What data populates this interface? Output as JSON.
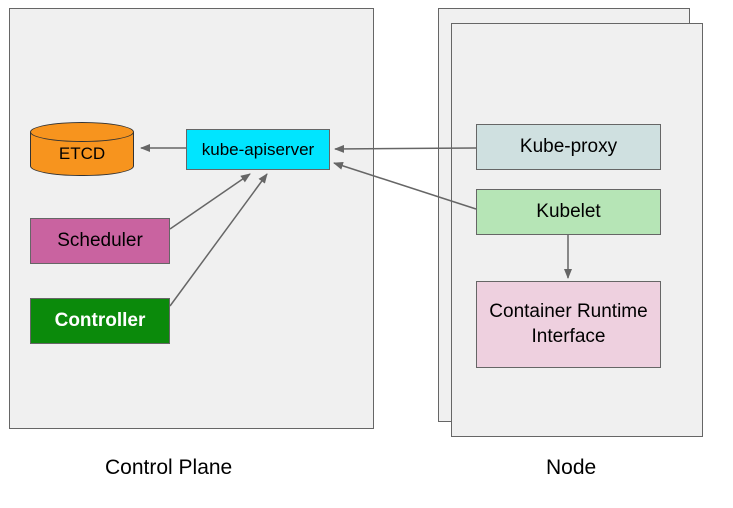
{
  "diagram": {
    "control_plane": {
      "label": "Control Plane",
      "etcd": "ETCD",
      "apiserver": "kube-apiserver",
      "scheduler": "Scheduler",
      "controller": "Controller"
    },
    "node": {
      "label": "Node",
      "kube_proxy": "Kube-proxy",
      "kubelet": "Kubelet",
      "cri": "Container Runtime Interface"
    },
    "colors": {
      "etcd": "#f7941e",
      "apiserver": "#00e5ff",
      "scheduler": "#c963a0",
      "controller": "#0b8a0b",
      "kube_proxy": "#cfe0e0",
      "kubelet": "#b6e5b6",
      "cri": "#eed0df",
      "container_bg": "#f0f0f0"
    },
    "arrows": [
      {
        "from": "kube-apiserver",
        "to": "etcd"
      },
      {
        "from": "scheduler",
        "to": "kube-apiserver"
      },
      {
        "from": "controller",
        "to": "kube-apiserver"
      },
      {
        "from": "kube-proxy",
        "to": "kube-apiserver"
      },
      {
        "from": "kubelet",
        "to": "kube-apiserver"
      },
      {
        "from": "kubelet",
        "to": "container-runtime-interface"
      }
    ]
  }
}
